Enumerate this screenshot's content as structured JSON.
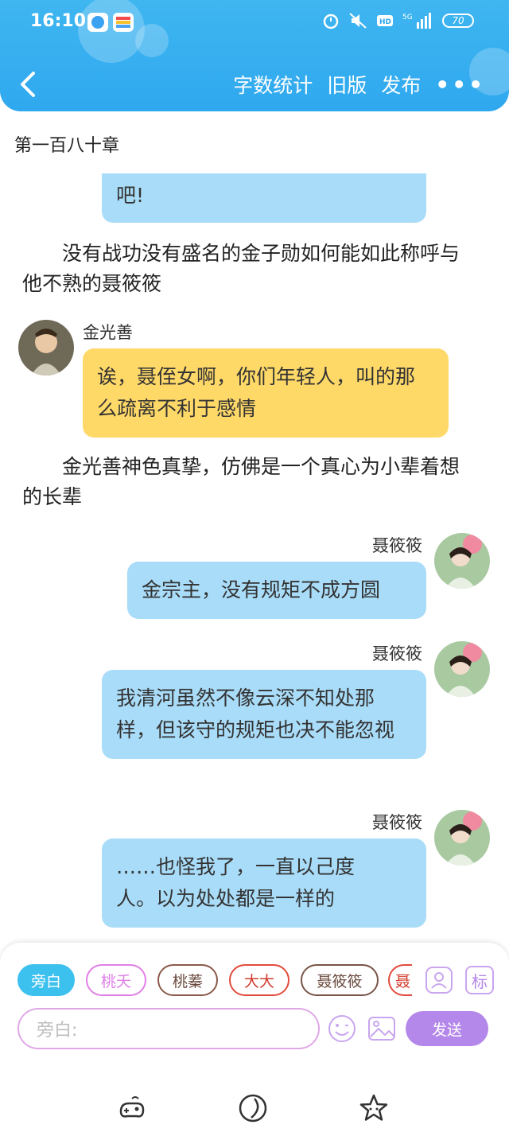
{
  "status_bar": {
    "time": "16:10",
    "network": "5G",
    "battery": "70"
  },
  "header": {
    "actions": [
      "字数统计",
      "旧版",
      "发布"
    ],
    "more": "•••"
  },
  "chapter_title": "第一百八十章",
  "messages": {
    "partial_bubble": "吧!",
    "narration1": "　　没有战功没有盛名的金子勋如何能如此称呼与他不熟的聂筱筱",
    "msg1_name": "金光善",
    "msg1_text": "诶，聂侄女啊，你们年轻人，叫的那么疏离不利于感情",
    "narration2": "　　金光善神色真挚，仿佛是一个真心为小辈着想的长辈",
    "msg2_name": "聂筱筱",
    "msg2_text": "金宗主，没有规矩不成方圆",
    "msg3_name": "聂筱筱",
    "msg3_text": "我清河虽然不像云深不知处那样，但该守的规矩也决不能忽视",
    "msg4_name": "聂筱筱",
    "msg4_text": "……也怪我了，一直以己度人。以为处处都是一样的"
  },
  "composer": {
    "chips": [
      "旁白",
      "桃夭",
      "桃蓁",
      "大大",
      "聂筱筱",
      "聂"
    ],
    "chip_colors": [
      "#3cc0ee",
      "#e07fe6",
      "#8a5a4a",
      "#e24b3b",
      "#7a5448",
      "#e24b3b"
    ],
    "tag_icon_label": "标",
    "input_placeholder": "旁白:",
    "send_label": "发送"
  },
  "colors": {
    "header": "#2fa8ef",
    "bubble_blue": "#a9dcf8",
    "bubble_yellow": "#ffd968",
    "send": "#b487ea"
  }
}
